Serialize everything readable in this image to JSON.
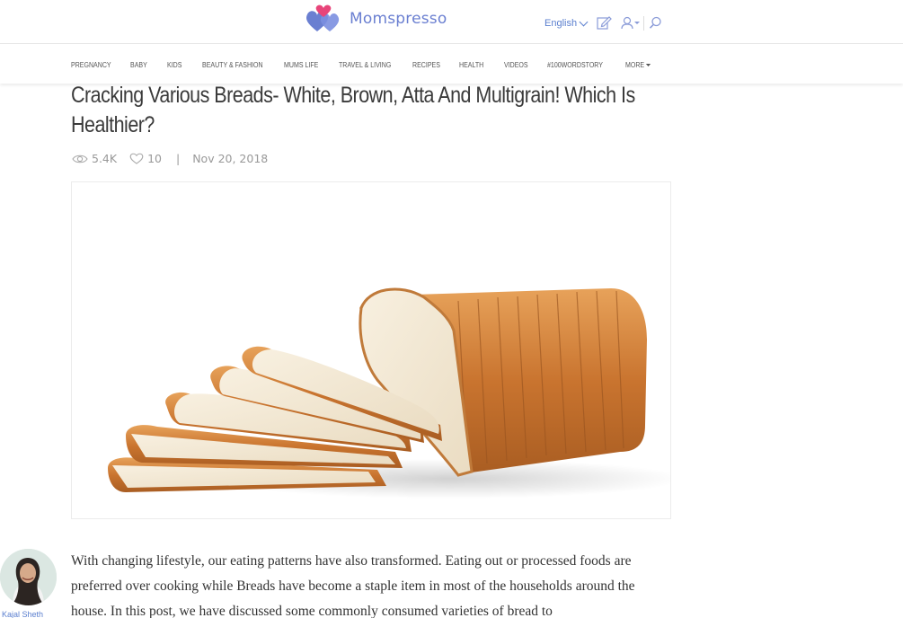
{
  "header": {
    "logo_text": "Momspresso",
    "language": "English",
    "icons": [
      "write-icon",
      "user-icon",
      "search-icon"
    ]
  },
  "nav": {
    "items": [
      "PREGNANCY",
      "BABY",
      "KIDS",
      "BEAUTY & FASHION",
      "MUMS LIFE",
      "TRAVEL & LIVING",
      "RECIPES",
      "HEALTH",
      "VIDEOS",
      "#100WORDSTORY",
      "MORE"
    ]
  },
  "article": {
    "title": "Cracking Various Breads- White, Brown, Atta And Multigrain! Which Is Healthier?",
    "views": "5.4K",
    "likes": "10",
    "separator": "|",
    "date": "Nov 20, 2018",
    "author": "Kajal Sheth",
    "body": "With changing lifestyle, our eating patterns have also transformed.  Eating out or processed foods are preferred over cooking while Breads have become a staple item in most of the households around the house. In this post, we have discussed some commonly consumed varieties of bread to"
  },
  "colors": {
    "brand_blue": "#6a7fd1",
    "brand_pink": "#e8457a",
    "link_blue": "#5b7fcf"
  }
}
